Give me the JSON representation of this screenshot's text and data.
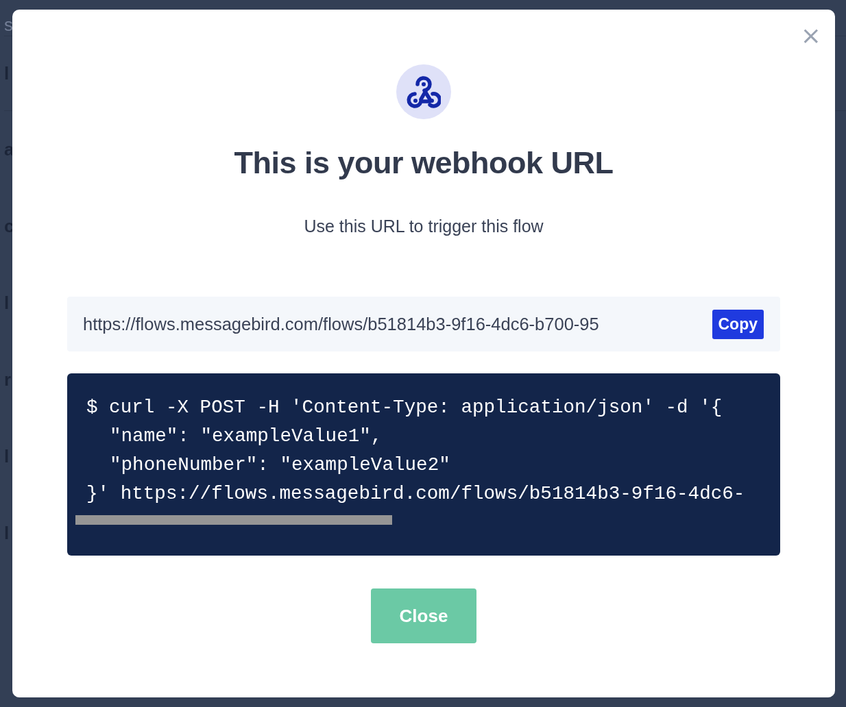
{
  "background_fragments": [
    "s",
    "l",
    "a",
    "c",
    "l",
    "r",
    "l",
    "l"
  ],
  "dialog": {
    "close_symbol": "×",
    "title": "This is your webhook URL",
    "subtitle": "Use this URL to trigger this flow",
    "url": "https://flows.messagebird.com/flows/b51814b3-9f16-4dc6-b700-95",
    "copy_button": "Copy",
    "code_lines": [
      {
        "text": "$ curl -X POST -H 'Content-Type: application/json' -d '{",
        "kind": "plain"
      },
      {
        "text": "\"name\": \"exampleValue1\",",
        "kind": "indented"
      },
      {
        "text": "\"phoneNumber\": \"exampleValue2\"",
        "kind": "indented"
      },
      {
        "text": "}' https://flows.messagebird.com/flows/b51814b3-9f16-4dc6-",
        "kind": "plain"
      },
      {
        "kind": "redacted"
      }
    ],
    "close_button": "Close"
  }
}
